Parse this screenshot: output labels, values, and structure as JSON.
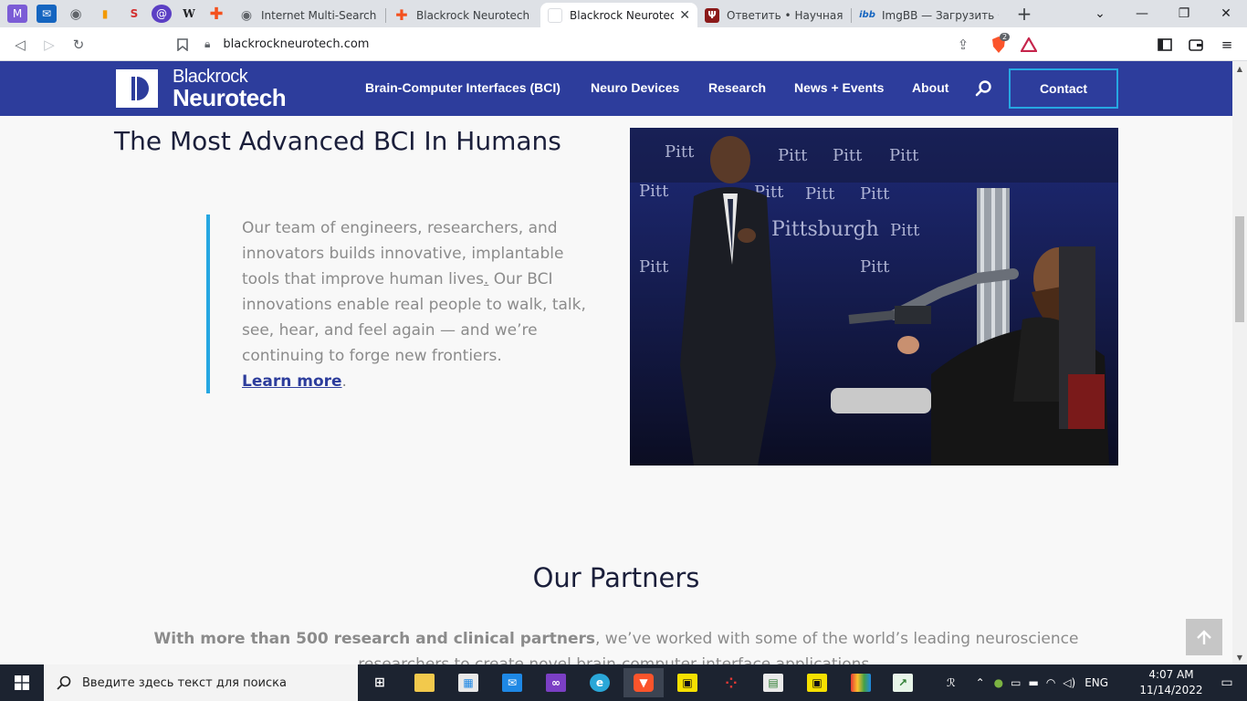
{
  "browser": {
    "tabs": [
      {
        "title": "Internet Multi-Search Eng",
        "active": false
      },
      {
        "title": "Blackrock Neurotech Arc",
        "active": false
      },
      {
        "title": "Blackrock Neurotech",
        "active": true
      },
      {
        "title": "Ответить • Научная ант",
        "active": false
      },
      {
        "title": "ImgBB — Загрузить Фот",
        "active": false
      }
    ],
    "url": "blackrockneurotech.com",
    "brave_badge": "2"
  },
  "site": {
    "logo": {
      "line1": "Blackrock",
      "line2": "Neurotech"
    },
    "nav": [
      "Brain-Computer Interfaces (BCI)",
      "Neuro Devices",
      "Research",
      "News + Events",
      "About"
    ],
    "contact": "Contact"
  },
  "hero": {
    "title": "The Most Advanced BCI In Humans",
    "body_part1": "Our team of engineers, researchers, and innovators builds innovative, implantable tools that improve human lives",
    "body_link_dot": ".",
    "body_part2": " Our BCI innovations enable real people to walk, talk, see, hear, and feel again — and we’re continuing to forge new frontiers.",
    "learn_more": "Learn more",
    "trailing": ".",
    "photo_banner_words": [
      "Pitt",
      "Pittsburgh"
    ]
  },
  "partners": {
    "title": "Our Partners",
    "strong": "With more than 500 research and clinical partners",
    "rest": ", we’ve worked with some of the world’s leading neuroscience researchers to create novel brain-computer interface applications."
  },
  "taskbar": {
    "search_placeholder": "Введите здесь текст для поиска",
    "lang": "ENG",
    "time": "4:07 AM",
    "date": "11/14/2022"
  },
  "colors": {
    "nav_bg": "#2d3d9c",
    "accent": "#26a7e2",
    "title": "#1b1f3b",
    "body_text": "#8b8b8b"
  }
}
